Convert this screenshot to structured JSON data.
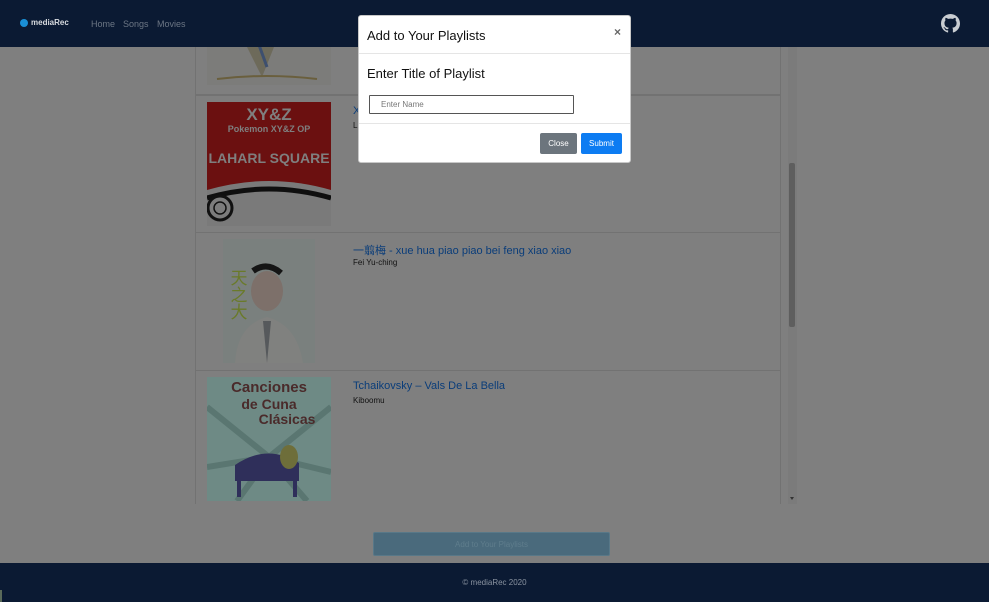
{
  "navbar": {
    "brand": "mediaRec",
    "links": [
      "Home",
      "Songs",
      "Movies"
    ],
    "github_icon": "github-icon"
  },
  "songs": [
    {
      "title": "",
      "artist": "",
      "cover_icon": "album-cover"
    },
    {
      "title": "X",
      "artist": "L",
      "cover_icon": "album-cover",
      "cover_text_1": "XY&Z",
      "cover_text_2": "Pokemon XY&Z OP",
      "cover_text_3": "LAHARL SQUARE"
    },
    {
      "title": "一翦梅 - xue hua piao piao bei feng xiao xiao",
      "artist": "Fei Yu-ching",
      "cover_icon": "album-cover",
      "cover_text_1": "天之大"
    },
    {
      "title": "Tchaikovsky – Vals De La Bella",
      "artist": "Kiboomu",
      "cover_icon": "album-cover",
      "cover_text_1": "Canciones",
      "cover_text_2": "de Cuna",
      "cover_text_3": "Clásicas"
    }
  ],
  "add_button": "Add to Your Playlists",
  "footer": "© mediaRec 2020",
  "modal": {
    "title": "Add to Your Playlists",
    "close_glyph": "×",
    "label": "Enter Title of Playlist",
    "input_placeholder": "Enter Name",
    "input_value": "",
    "close_button": "Close",
    "submit_button": "Submit"
  },
  "colors": {
    "navbar": "#0b1a33",
    "link": "#0a3d7a",
    "submit": "#0d7cf2",
    "close_btn": "#6c757d"
  }
}
